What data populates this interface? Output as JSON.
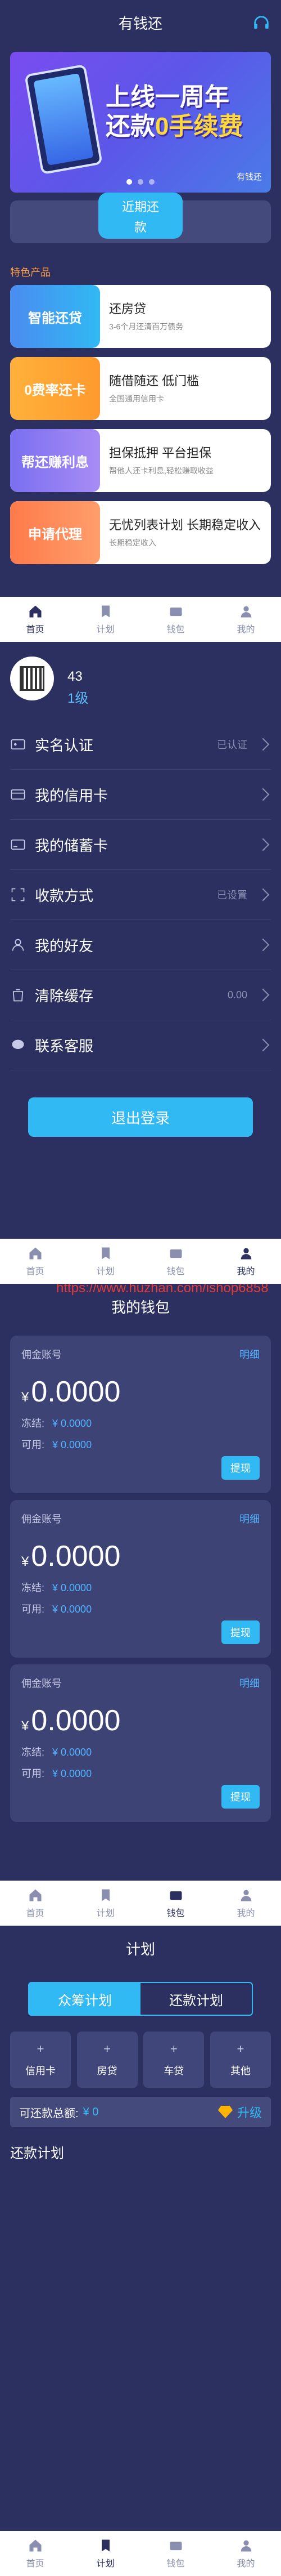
{
  "home": {
    "title": "有钱还",
    "banner": {
      "line1": "上线一周年",
      "line2_a": "还款",
      "line2_b": "0手续费",
      "brand": "有钱还"
    },
    "recent": {
      "label1": "近期还",
      "label2": "款"
    },
    "section_label": "特色产品",
    "products": [
      {
        "tag": "智能还贷",
        "title": "还房贷",
        "desc": "3-6个月还清百万债务",
        "c1": "#4a8cf0",
        "c2": "#31b9f3"
      },
      {
        "tag": "0费率还卡",
        "title": "随借随还 低门槛",
        "desc": "全国通用信用卡",
        "c1": "#ffb13b",
        "c2": "#ff9a2e"
      },
      {
        "tag": "帮还赚利息",
        "title": "担保抵押 平台担保",
        "desc": "帮他人还卡利息,轻松赚取收益",
        "c1": "#7a6ff0",
        "c2": "#a88cf5"
      },
      {
        "tag": "申请代理",
        "title": "无忧列表计划 长期稳定收入",
        "desc": "长期稳定收入",
        "c1": "#ff7a4b",
        "c2": "#ff9e6b"
      }
    ]
  },
  "tabs": [
    "首页",
    "计划",
    "钱包",
    "我的"
  ],
  "profile": {
    "name": "43",
    "level": "1级",
    "menu": [
      {
        "name": "实名认证",
        "value": "已认证",
        "icon": "id-card-icon"
      },
      {
        "name": "我的信用卡",
        "value": "",
        "icon": "credit-card-icon"
      },
      {
        "name": "我的储蓄卡",
        "value": "",
        "icon": "debit-card-icon"
      },
      {
        "name": "收款方式",
        "value": "已设置",
        "icon": "scan-icon"
      },
      {
        "name": "我的好友",
        "value": "",
        "icon": "friend-icon"
      },
      {
        "name": "清除缓存",
        "value": "0.00",
        "icon": "trash-icon"
      },
      {
        "name": "联系客服",
        "value": "",
        "icon": "chat-icon"
      }
    ],
    "logout": "退出登录"
  },
  "wallet": {
    "title": "我的钱包",
    "watermark": "https://www.huzhan.com/ishop6858",
    "cards": [
      {
        "acc": "佣金账号",
        "detail": "明细",
        "currency": "¥",
        "amount": "0.0000",
        "frozen_label": "冻结:",
        "frozen": "¥ 0.0000",
        "avail_label": "可用:",
        "avail": "¥ 0.0000",
        "btn": "提现"
      },
      {
        "acc": "佣金账号",
        "detail": "明细",
        "currency": "¥",
        "amount": "0.0000",
        "frozen_label": "冻结:",
        "frozen": "¥ 0.0000",
        "avail_label": "可用:",
        "avail": "¥ 0.0000",
        "btn": "提现"
      },
      {
        "acc": "佣金账号",
        "detail": "明细",
        "currency": "¥",
        "amount": "0.0000",
        "frozen_label": "冻结:",
        "frozen": "¥ 0.0000",
        "avail_label": "可用:",
        "avail": "¥ 0.0000",
        "btn": "提现"
      }
    ]
  },
  "plan": {
    "title": "计划",
    "seg1": "众筹计划",
    "seg2": "还款计划",
    "cats": [
      "信用卡",
      "房贷",
      "车贷",
      "其他"
    ],
    "total_label": "可还款总额:",
    "total_value": "¥ 0",
    "upgrade": "升级",
    "list_title": "还款计划"
  }
}
